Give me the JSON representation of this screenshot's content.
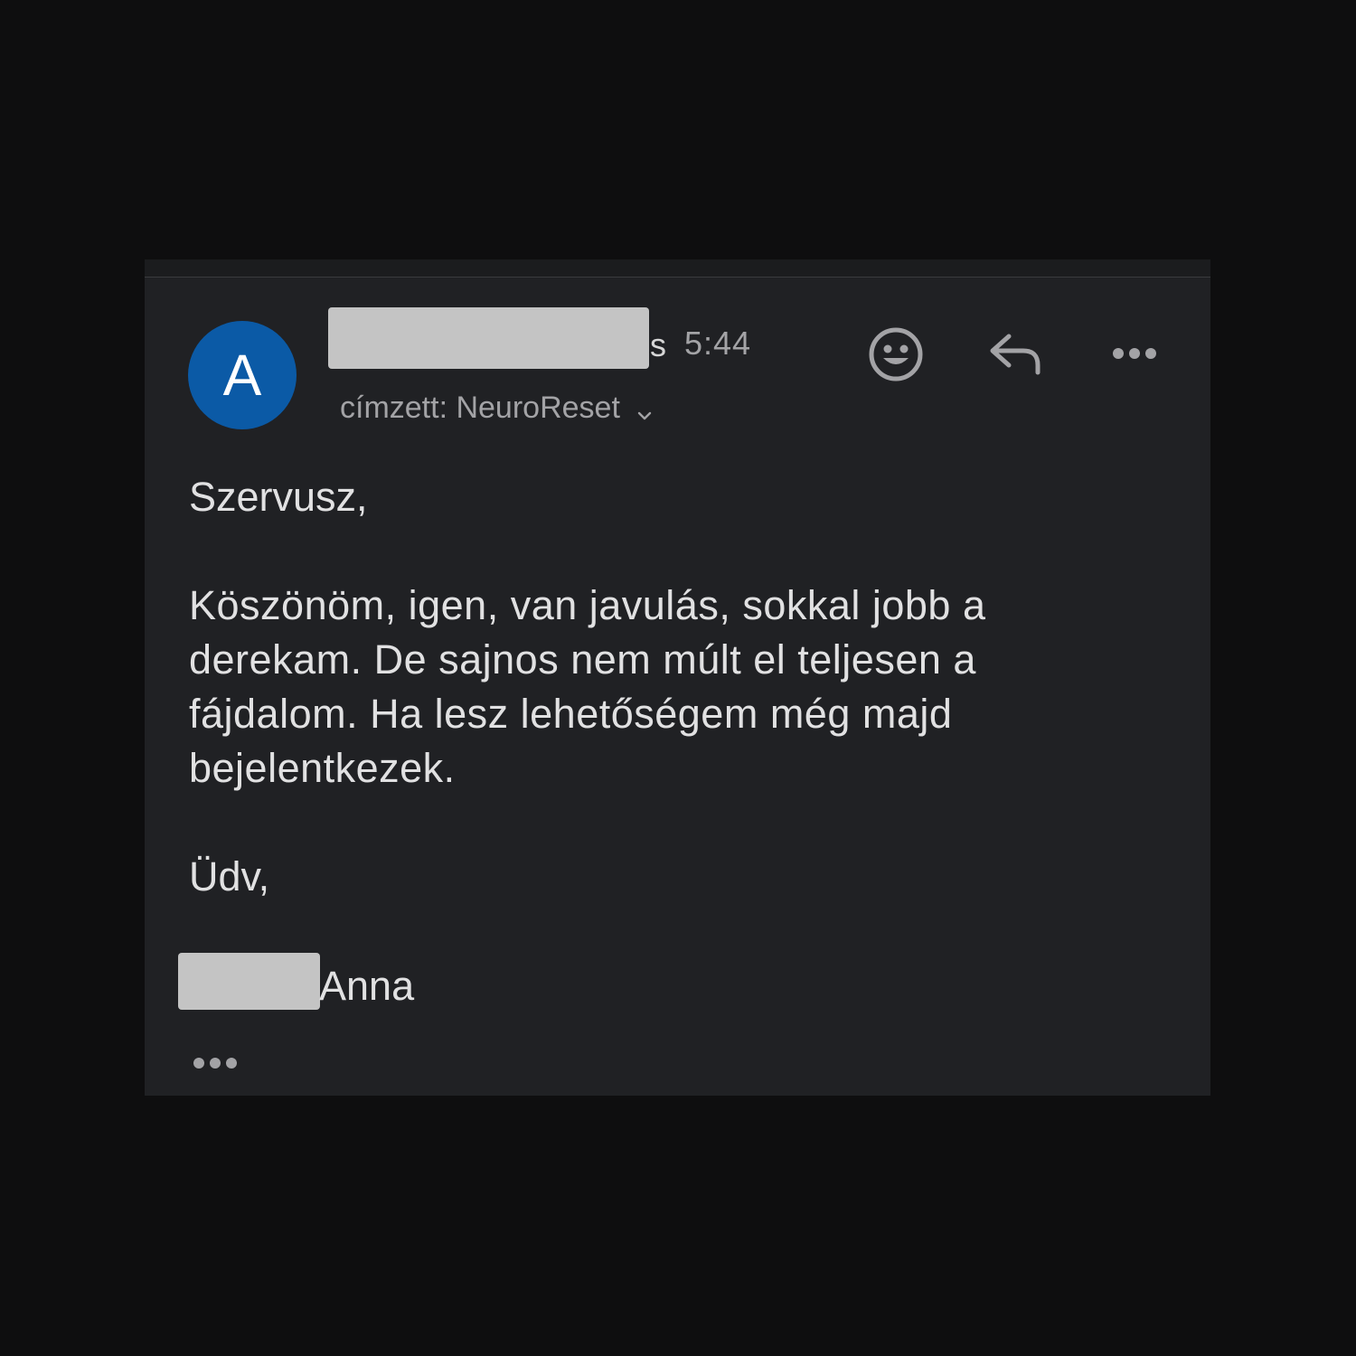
{
  "message": {
    "avatar_letter": "A",
    "sender_visible_tail": "s",
    "time": "5:44",
    "recipient_label": "címzett: NeuroReset",
    "body": {
      "greeting": "Szervusz,",
      "paragraph": "Köszönöm, igen, van javulás, sokkal jobb a derekam. De sajnos nem múlt el teljesen a fájdalom. Ha lesz lehetőségem még majd bejelentkezek.",
      "closing": "Üdv,",
      "signature_visible": "Anna"
    }
  },
  "icons": {
    "react": "smiley-face-icon",
    "reply": "reply-arrow-icon",
    "more": "more-options-icon",
    "recipient_toggle": "chevron-down-icon",
    "expand": "ellipsis-expand-icon"
  },
  "colors": {
    "page_background": "#0e0e0f",
    "card_background": "#202124",
    "avatar": "#0b5aa6",
    "primary_text": "#e1e1e2",
    "secondary_text": "#a3a3a6",
    "redaction": "#c4c4c4"
  }
}
